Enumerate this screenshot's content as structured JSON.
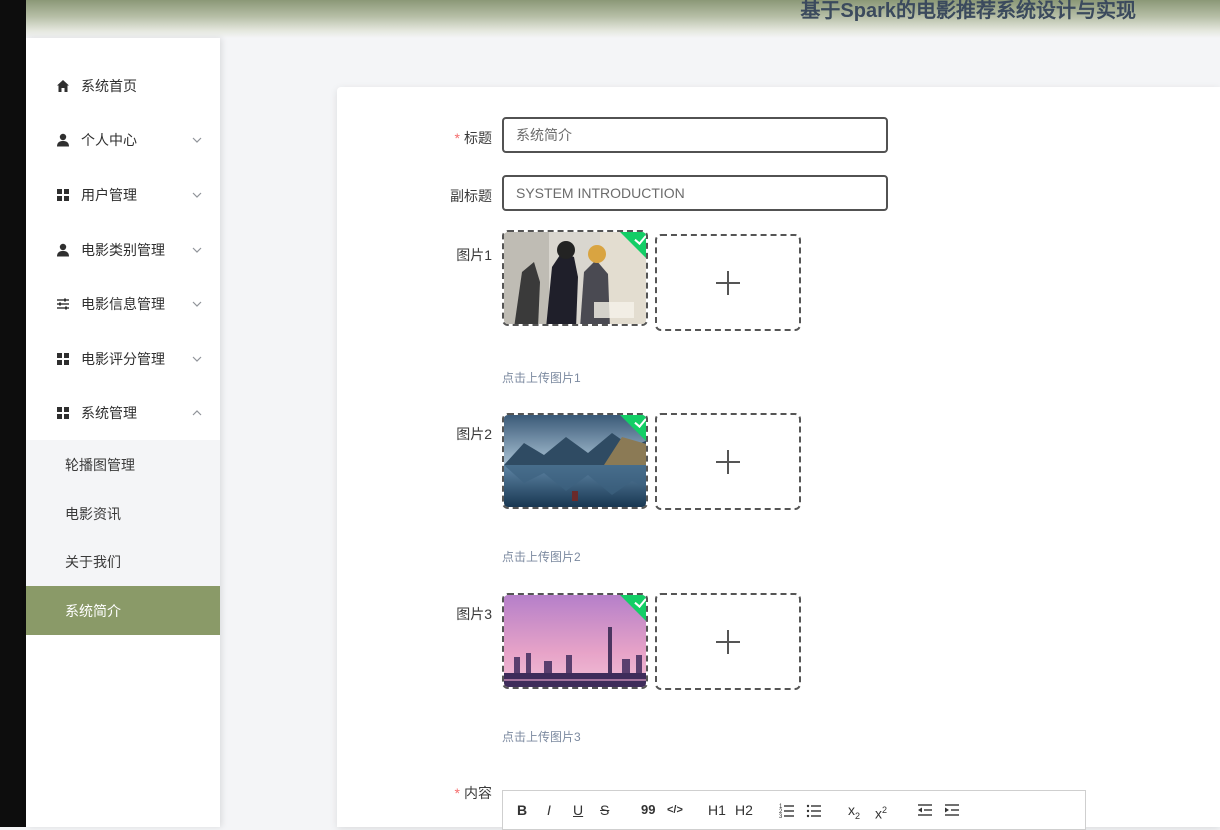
{
  "header": {
    "title": "基于Spark的电影推荐系统设计与实现"
  },
  "sidebar": {
    "items": [
      {
        "label": "系统首页",
        "icon": "home-icon"
      },
      {
        "label": "个人中心",
        "icon": "user-icon"
      },
      {
        "label": "用户管理",
        "icon": "grid-icon"
      },
      {
        "label": "电影类别管理",
        "icon": "user-icon"
      },
      {
        "label": "电影信息管理",
        "icon": "sliders-icon"
      },
      {
        "label": "电影评分管理",
        "icon": "grid-icon"
      },
      {
        "label": "系统管理",
        "icon": "grid-icon"
      }
    ],
    "submenu": [
      {
        "label": "轮播图管理"
      },
      {
        "label": "电影资讯"
      },
      {
        "label": "关于我们"
      },
      {
        "label": "系统简介",
        "active": true
      }
    ]
  },
  "form": {
    "title_label": "标题",
    "title_value": "系统简介",
    "subtitle_label": "副标题",
    "subtitle_value": "SYSTEM INTRODUCTION",
    "images": [
      {
        "label": "图片1",
        "tip": "点击上传图片1"
      },
      {
        "label": "图片2",
        "tip": "点击上传图片2"
      },
      {
        "label": "图片3",
        "tip": "点击上传图片3"
      }
    ],
    "content_label": "内容",
    "toolbar": [
      "B",
      "I",
      "U",
      "S",
      "99",
      "</>",
      "H1",
      "H2",
      "ol",
      "ul",
      "x2",
      "x2",
      "outdent",
      "indent"
    ]
  },
  "colors": {
    "accent": "#8a9a68",
    "required": "#f56c6c",
    "success": "#13ce66"
  }
}
